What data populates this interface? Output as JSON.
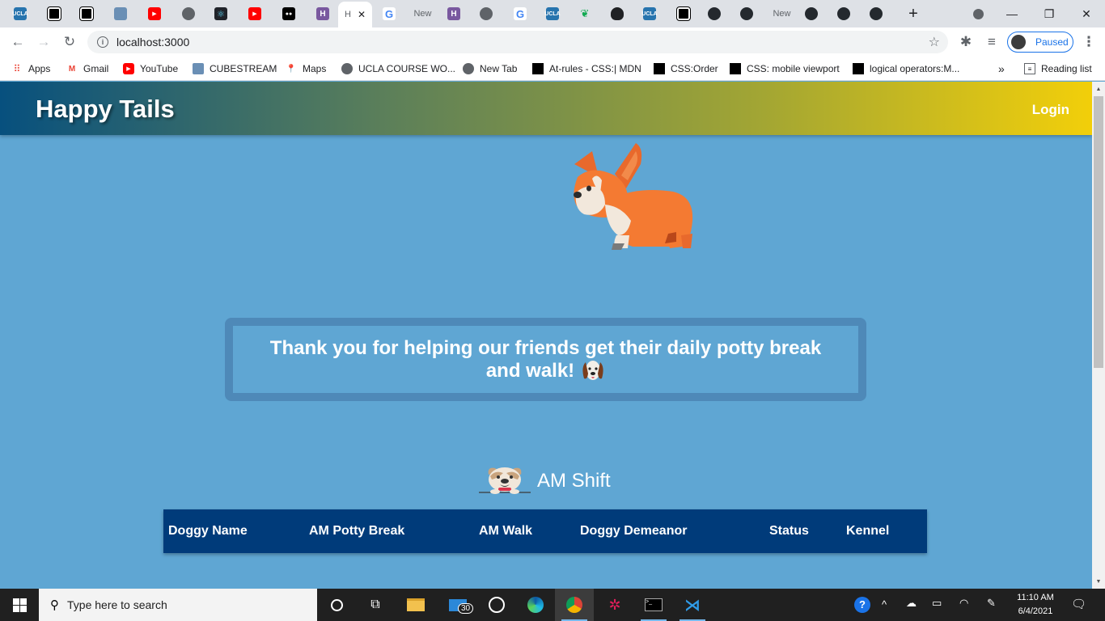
{
  "browser": {
    "tabs": [
      {
        "icon": "ucla-icon",
        "label": ""
      },
      {
        "icon": "codepen-icon",
        "label": ""
      },
      {
        "icon": "codepen-icon",
        "label": ""
      },
      {
        "icon": "cube-icon",
        "label": ""
      },
      {
        "icon": "youtube-icon",
        "label": ""
      },
      {
        "icon": "globe-icon",
        "label": ""
      },
      {
        "icon": "react-icon",
        "label": ""
      },
      {
        "icon": "youtube-icon",
        "label": ""
      },
      {
        "icon": "medium-icon",
        "label": ""
      },
      {
        "icon": "heroku-icon",
        "label": ""
      },
      {
        "icon": "active-tab",
        "label": "H"
      },
      {
        "icon": "google-icon",
        "label": ""
      },
      {
        "icon": "blank",
        "label": "New"
      },
      {
        "icon": "heroku-icon",
        "label": ""
      },
      {
        "icon": "globe-icon",
        "label": ""
      },
      {
        "icon": "google-icon",
        "label": ""
      },
      {
        "icon": "ucla-icon",
        "label": ""
      },
      {
        "icon": "leaf-icon",
        "label": ""
      },
      {
        "icon": "bag-icon",
        "label": ""
      },
      {
        "icon": "ucla-icon",
        "label": ""
      },
      {
        "icon": "codepen-icon",
        "label": ""
      },
      {
        "icon": "github-icon",
        "label": ""
      },
      {
        "icon": "github-icon",
        "label": ""
      },
      {
        "icon": "blank",
        "label": "New"
      },
      {
        "icon": "github-icon",
        "label": ""
      },
      {
        "icon": "github-icon",
        "label": ""
      },
      {
        "icon": "github-icon",
        "label": ""
      }
    ],
    "new_tab_symbol": "+",
    "close_tab_symbol": "✕",
    "url": "localhost:3000",
    "profile_label": "Paused",
    "bookmarks": [
      {
        "icon": "apps-grid-icon",
        "label": "Apps"
      },
      {
        "icon": "gmail-icon",
        "label": "Gmail"
      },
      {
        "icon": "youtube-icon",
        "label": "YouTube"
      },
      {
        "icon": "cube-icon",
        "label": "CUBESTREAM"
      },
      {
        "icon": "maps-icon",
        "label": "Maps"
      },
      {
        "icon": "globe-icon",
        "label": "UCLA COURSE WO..."
      },
      {
        "icon": "globe-icon",
        "label": "New Tab"
      },
      {
        "icon": "codepen-icon",
        "label": "At-rules - CSS:| MDN"
      },
      {
        "icon": "codepen-icon",
        "label": "CSS:Order"
      },
      {
        "icon": "codepen-icon",
        "label": "CSS: mobile viewport"
      },
      {
        "icon": "codepen-icon",
        "label": "logical operators:M..."
      }
    ],
    "bookmarks_overflow": "»",
    "reading_list": "Reading list"
  },
  "app": {
    "brand": "Happy Tails",
    "login": "Login",
    "thanks_line1": "Thank you for helping our friends get their daily potty break",
    "thanks_line2": "and walk!",
    "shift_title": "AM Shift",
    "table_headers": [
      "Doggy Name",
      "AM Potty Break",
      "AM Walk",
      "Doggy Demeanor",
      "Status",
      "Kennel"
    ]
  },
  "taskbar": {
    "search_placeholder": "Type here to search",
    "mail_badge": "30",
    "time": "11:10 AM",
    "date": "6/4/2021"
  },
  "colors": {
    "page_bg": "#5fa6d3",
    "table_header": "#003b7a",
    "navbar_start": "#07507e",
    "navbar_end": "#f2cf0a"
  }
}
